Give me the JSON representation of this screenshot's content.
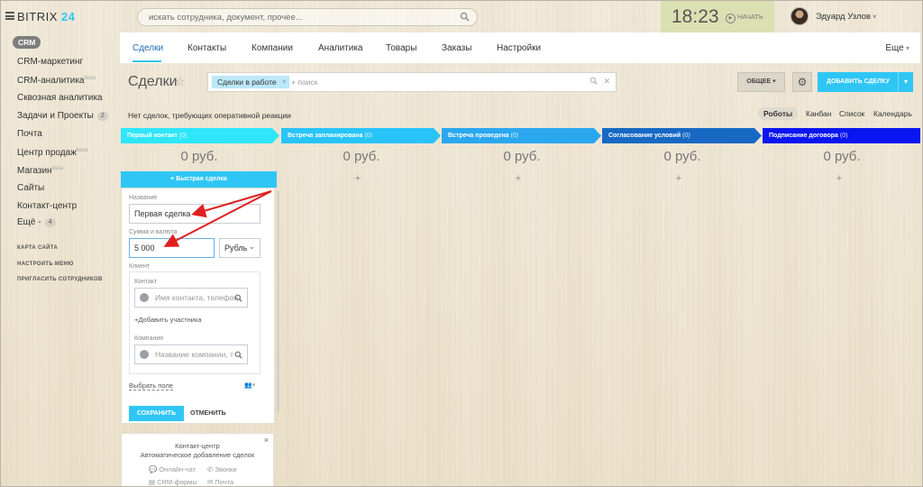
{
  "app": {
    "logo_text": "BITRIX",
    "logo_num": "24"
  },
  "header": {
    "search_placeholder": "искать сотрудника, документ, прочее...",
    "clock": "18:23",
    "start_label": "НАЧАТЬ",
    "user_name": "Эдуард Узлов"
  },
  "sidebar": {
    "crm_badge": "CRM",
    "items": [
      {
        "label": "CRM-маркетинг"
      },
      {
        "label": "CRM-аналитика",
        "beta": "beta"
      },
      {
        "label": "Сквозная аналитика"
      },
      {
        "label": "Задачи и Проекты",
        "count": "2"
      },
      {
        "label": "Почта"
      },
      {
        "label": "Центр продаж",
        "beta": "beta"
      },
      {
        "label": "Магазин",
        "beta": "beta"
      },
      {
        "label": "Сайты"
      },
      {
        "label": "Контакт-центр"
      },
      {
        "label": "Ещё -",
        "count": "4"
      }
    ],
    "links": [
      "КАРТА САЙТА",
      "НАСТРОИТЬ МЕНЮ",
      "ПРИГЛАСИТЬ СОТРУДНИКОВ"
    ]
  },
  "tabs": {
    "items": [
      "Сделки",
      "Контакты",
      "Компании",
      "Аналитика",
      "Товары",
      "Заказы",
      "Настройки"
    ],
    "more": "Еще"
  },
  "toolbar": {
    "title": "Сделки",
    "filter_tag": "Сделки в работе",
    "filter_placeholder": "+ поиск",
    "general_btn": "ОБЩЕЕ",
    "add_btn": "ДОБАВИТЬ СДЕЛКУ"
  },
  "subheader": {
    "notice": "Нет сделок, требующих оперативной реакции",
    "views": [
      "Роботы",
      "Канбан",
      "Список",
      "Календарь"
    ]
  },
  "stages": [
    {
      "name": "Первый контакт",
      "count": "(0)",
      "sum": "0 руб.",
      "color": "#2fe6fa"
    },
    {
      "name": "Встреча запланирована",
      "count": "(0)",
      "sum": "0 руб.",
      "color": "#29c4f7"
    },
    {
      "name": "Встреча проведена",
      "count": "(0)",
      "sum": "0 руб.",
      "color": "#2aa7ef"
    },
    {
      "name": "Согласование условий",
      "count": "(0)",
      "sum": "0 руб.",
      "color": "#1769c4"
    },
    {
      "name": "Подписание договора",
      "count": "(0)",
      "sum": "0 руб.",
      "color": "#0a16f0"
    }
  ],
  "quick_form": {
    "button": "+ Быстрая сделка",
    "name_label": "Название",
    "name_value": "Первая сделка",
    "amount_label": "Сумма и валюта",
    "amount_value": "5 000",
    "currency": "Рубль",
    "client_label": "Клиент",
    "contact_label": "Контакт",
    "contact_placeholder": "Имя контакта, телефон",
    "add_participant": "+Добавить участника",
    "company_label": "Компания",
    "company_placeholder": "Название компании, т",
    "choose_field": "Выбрать поле",
    "save": "СОХРАНИТЬ",
    "cancel": "ОТМЕНИТЬ"
  },
  "contact_center": {
    "title": "Контакт-центр",
    "subtitle": "Автоматическое добавление сделок",
    "items": [
      "Онлайн-чат",
      "Звонки",
      "CRM-формы",
      "Почта"
    ]
  },
  "colors": {
    "accent": "#2fc6f6",
    "annotation": "#e02020"
  }
}
